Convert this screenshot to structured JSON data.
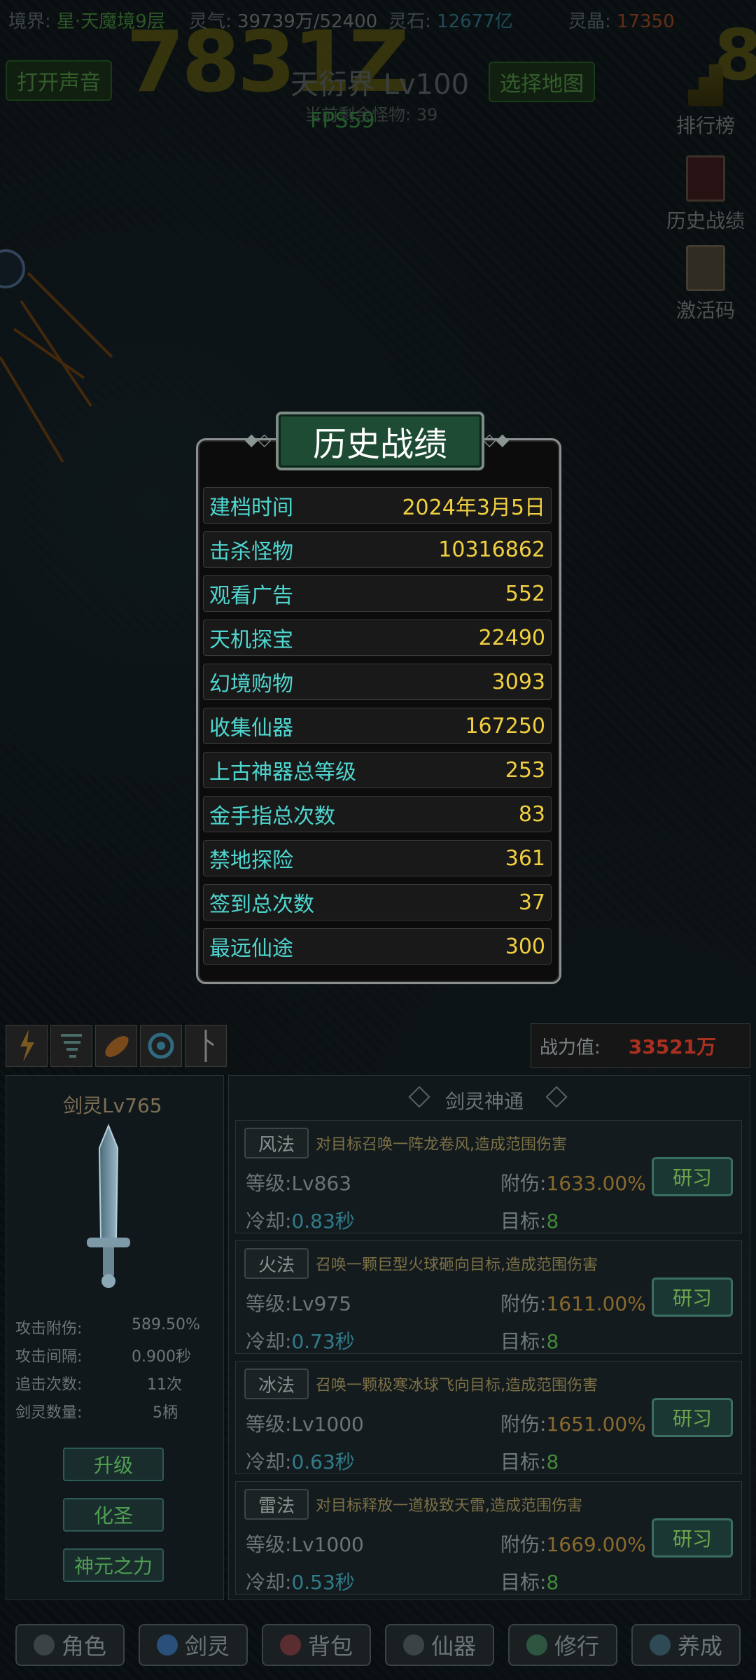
{
  "status_bar": {
    "realm_label": "境界:",
    "realm_value": "星·天魔境9层",
    "qi_label": "灵气:",
    "qi_value": "39739万/52400",
    "stone_label": "灵石:",
    "stone_value": "12677亿",
    "crystal_label": "灵晶:",
    "crystal_value": "17350"
  },
  "hud": {
    "big_damage": "7831Z",
    "big_damage_right": "8",
    "sound_button": "打开声音",
    "map_button": "选择地图",
    "world_title": "天衍界 Lv100",
    "remaining_text": "当前剩余怪物: 39",
    "fps": "FPS59"
  },
  "right_menu": [
    {
      "label": "排行榜",
      "icon": "leaderboard-icon"
    },
    {
      "label": "历史战绩",
      "icon": "record-book-icon"
    },
    {
      "label": "激活码",
      "icon": "code-book-icon"
    }
  ],
  "modal": {
    "title": "历史战绩",
    "rows": [
      {
        "key": "建档时间",
        "value": "2024年3月5日"
      },
      {
        "key": "击杀怪物",
        "value": "10316862"
      },
      {
        "key": "观看广告",
        "value": "552"
      },
      {
        "key": "天机探宝",
        "value": "22490"
      },
      {
        "key": "幻境购物",
        "value": "3093"
      },
      {
        "key": "收集仙器",
        "value": "167250"
      },
      {
        "key": "上古神器总等级",
        "value": "253"
      },
      {
        "key": "金手指总次数",
        "value": "83"
      },
      {
        "key": "禁地探险",
        "value": "361"
      },
      {
        "key": "签到总次数",
        "value": "37"
      },
      {
        "key": "最远仙途",
        "value": "300"
      }
    ]
  },
  "power": {
    "label": "战力值:",
    "value": "33521万"
  },
  "sword_spirit": {
    "title": "剑灵Lv765",
    "stats": [
      {
        "label": "攻击附伤:",
        "value": "589.50%"
      },
      {
        "label": "攻击间隔:",
        "value": "0.900秒"
      },
      {
        "label": "追击次数:",
        "value": "11次"
      },
      {
        "label": "剑灵数量:",
        "value": "5柄"
      }
    ],
    "buttons": [
      "升级",
      "化圣",
      "神元之力"
    ]
  },
  "skills": {
    "heading": "剑灵神通",
    "level_label": "等级:",
    "damage_label": "附伤:",
    "cooldown_label": "冷却:",
    "target_label": "目标:",
    "study_label": "研习",
    "cards": [
      {
        "tag": "风法",
        "desc": "对目标召唤一阵龙卷风,造成范围伤害",
        "level": "Lv863",
        "damage": "1633.00%",
        "cooldown": "0.83秒",
        "target": "8"
      },
      {
        "tag": "火法",
        "desc": "召唤一颗巨型火球砸向目标,造成范围伤害",
        "level": "Lv975",
        "damage": "1611.00%",
        "cooldown": "0.73秒",
        "target": "8"
      },
      {
        "tag": "冰法",
        "desc": "召唤一颗极寒冰球飞向目标,造成范围伤害",
        "level": "Lv1000",
        "damage": "1651.00%",
        "cooldown": "0.63秒",
        "target": "8"
      },
      {
        "tag": "雷法",
        "desc": "对目标释放一道极致天雷,造成范围伤害",
        "level": "Lv1000",
        "damage": "1669.00%",
        "cooldown": "0.53秒",
        "target": "8"
      }
    ]
  },
  "bottom_nav": [
    {
      "label": "角色",
      "icon": "character-icon"
    },
    {
      "label": "剑灵",
      "icon": "sword-spirit-icon"
    },
    {
      "label": "背包",
      "icon": "backpack-icon"
    },
    {
      "label": "仙器",
      "icon": "artifact-icon"
    },
    {
      "label": "修行",
      "icon": "cultivate-icon"
    },
    {
      "label": "养成",
      "icon": "nurture-icon"
    }
  ]
}
